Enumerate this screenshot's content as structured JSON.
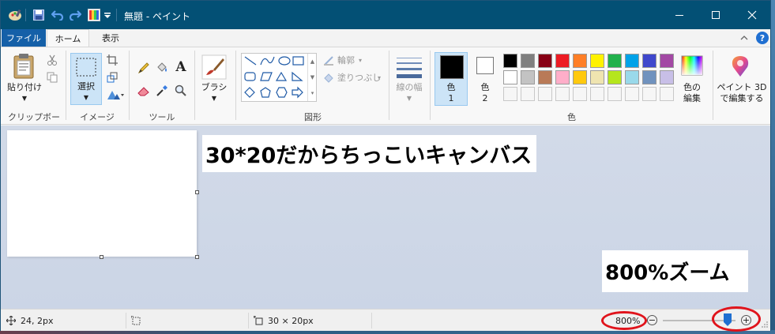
{
  "window": {
    "title": "無題 - ペイント",
    "controls": [
      "minimize",
      "maximize",
      "close"
    ]
  },
  "quick_access": {
    "icons": [
      "paint-app-icon",
      "save-icon",
      "undo-icon",
      "redo-icon",
      "palette-icon",
      "customize-dropdown-icon"
    ]
  },
  "tabs": {
    "file": "ファイル",
    "home": "ホーム",
    "view": "表示"
  },
  "ribbon": {
    "clipboard": {
      "paste": "貼り付け",
      "group": "クリップボード"
    },
    "image": {
      "select": "選択",
      "group": "イメージ"
    },
    "tools": {
      "group": "ツール"
    },
    "brushes": {
      "label": "ブラシ"
    },
    "shapes": {
      "outline": "輪郭",
      "fill": "塗りつぶし",
      "group": "図形"
    },
    "size": {
      "label": "線の幅"
    },
    "colors": {
      "color1": "色",
      "color1_num": "1",
      "color2": "色",
      "color2_num": "2",
      "edit_line1": "色の",
      "edit_line2": "編集",
      "group": "色",
      "color1_value": "#000000",
      "color2_value": "#ffffff",
      "palette_row1": [
        "#000000",
        "#7f7f7f",
        "#880015",
        "#ed1c24",
        "#ff7f27",
        "#fff200",
        "#22b14c",
        "#00a2e8",
        "#3f48cc",
        "#a349a4"
      ],
      "palette_row2": [
        "#ffffff",
        "#c3c3c3",
        "#b97a57",
        "#ffaec9",
        "#ffc90e",
        "#efe4b0",
        "#b5e61d",
        "#99d9ea",
        "#7092be",
        "#c8bfe7"
      ]
    },
    "paint3d": {
      "line1": "ペイント 3D",
      "line2": "で編集する"
    }
  },
  "canvas": {
    "note_size": "30*20だからちっこいキャンバス",
    "note_zoom": "800%ズーム"
  },
  "statusbar": {
    "position": "24, 2px",
    "selection_size": "",
    "image_size": "30 × 20px",
    "zoom": "800%",
    "zoom_level_percent": 800
  },
  "colors": {
    "titlebar": "#035075",
    "file_tab": "#1560a8",
    "annotation_red": "#e0141c"
  }
}
